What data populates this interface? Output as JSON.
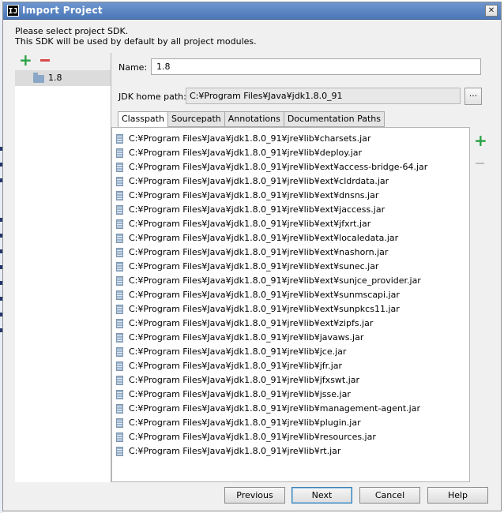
{
  "window": {
    "title": "Import Project",
    "app_icon_glyph": "IJ",
    "close_glyph": "✕"
  },
  "intro": {
    "line1": "Please select project SDK.",
    "line2": "This SDK will be used by default by all project modules."
  },
  "sdk_list": {
    "items": [
      {
        "label": "1.8",
        "icon": "folder-icon"
      }
    ]
  },
  "form": {
    "name_label": "Name:",
    "name_value": "1.8",
    "jdk_home_label": "JDK home path:",
    "jdk_home_value": "C:¥Program Files¥Java¥jdk1.8.0_91",
    "browse_label": "..."
  },
  "tabs": [
    {
      "label": "Classpath",
      "active": true
    },
    {
      "label": "Sourcepath",
      "active": false
    },
    {
      "label": "Annotations",
      "active": false
    },
    {
      "label": "Documentation Paths",
      "active": false
    }
  ],
  "classpath": [
    "C:¥Program Files¥Java¥jdk1.8.0_91¥jre¥lib¥charsets.jar",
    "C:¥Program Files¥Java¥jdk1.8.0_91¥jre¥lib¥deploy.jar",
    "C:¥Program Files¥Java¥jdk1.8.0_91¥jre¥lib¥ext¥access-bridge-64.jar",
    "C:¥Program Files¥Java¥jdk1.8.0_91¥jre¥lib¥ext¥cldrdata.jar",
    "C:¥Program Files¥Java¥jdk1.8.0_91¥jre¥lib¥ext¥dnsns.jar",
    "C:¥Program Files¥Java¥jdk1.8.0_91¥jre¥lib¥ext¥jaccess.jar",
    "C:¥Program Files¥Java¥jdk1.8.0_91¥jre¥lib¥ext¥jfxrt.jar",
    "C:¥Program Files¥Java¥jdk1.8.0_91¥jre¥lib¥ext¥localedata.jar",
    "C:¥Program Files¥Java¥jdk1.8.0_91¥jre¥lib¥ext¥nashorn.jar",
    "C:¥Program Files¥Java¥jdk1.8.0_91¥jre¥lib¥ext¥sunec.jar",
    "C:¥Program Files¥Java¥jdk1.8.0_91¥jre¥lib¥ext¥sunjce_provider.jar",
    "C:¥Program Files¥Java¥jdk1.8.0_91¥jre¥lib¥ext¥sunmscapi.jar",
    "C:¥Program Files¥Java¥jdk1.8.0_91¥jre¥lib¥ext¥sunpkcs11.jar",
    "C:¥Program Files¥Java¥jdk1.8.0_91¥jre¥lib¥ext¥zipfs.jar",
    "C:¥Program Files¥Java¥jdk1.8.0_91¥jre¥lib¥javaws.jar",
    "C:¥Program Files¥Java¥jdk1.8.0_91¥jre¥lib¥jce.jar",
    "C:¥Program Files¥Java¥jdk1.8.0_91¥jre¥lib¥jfr.jar",
    "C:¥Program Files¥Java¥jdk1.8.0_91¥jre¥lib¥jfxswt.jar",
    "C:¥Program Files¥Java¥jdk1.8.0_91¥jre¥lib¥jsse.jar",
    "C:¥Program Files¥Java¥jdk1.8.0_91¥jre¥lib¥management-agent.jar",
    "C:¥Program Files¥Java¥jdk1.8.0_91¥jre¥lib¥plugin.jar",
    "C:¥Program Files¥Java¥jdk1.8.0_91¥jre¥lib¥resources.jar",
    "C:¥Program Files¥Java¥jdk1.8.0_91¥jre¥lib¥rt.jar"
  ],
  "buttons": {
    "previous": "Previous",
    "next": "Next",
    "cancel": "Cancel",
    "help": "Help"
  },
  "colors": {
    "title_bar": "#4c78b8",
    "add_green": "#2aa245",
    "remove_red": "#d84a4a"
  }
}
